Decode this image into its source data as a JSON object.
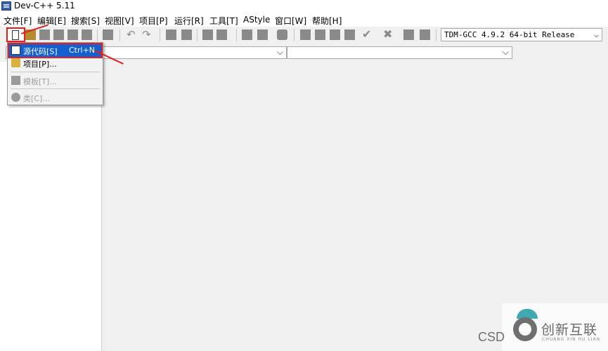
{
  "window": {
    "title": "Dev-C++ 5.11"
  },
  "menu": [
    "文件[F]",
    "编辑[E]",
    "搜索[S]",
    "视图[V]",
    "项目[P]",
    "运行[R]",
    "工具[T]",
    "AStyle",
    "窗口[W]",
    "帮助[H]"
  ],
  "toolbar": {
    "compiler_selected": "TDM-GCC 4.9.2 64-bit Release",
    "buttons": [
      "new-file",
      "open",
      "save",
      "save-all",
      "close",
      "print",
      "undo",
      "redo",
      "indent",
      "unindent",
      "toggle-bookmark",
      "goto-bookmark",
      "goto",
      "new-project",
      "add-to-project",
      "remove-from-project",
      "compile",
      "run",
      "compile-run",
      "rebuild",
      "debug",
      "stop",
      "profile",
      "clean",
      "options"
    ]
  },
  "new_menu": {
    "items": [
      {
        "label": "源代码[S]",
        "shortcut": "Ctrl+N",
        "enabled": true,
        "selected": true,
        "icon": "file-icon"
      },
      {
        "label": "项目[P]...",
        "shortcut": "",
        "enabled": true,
        "selected": false,
        "icon": "project-icon"
      },
      {
        "label": "模板[T]...",
        "shortcut": "",
        "enabled": false,
        "selected": false,
        "icon": "template-icon"
      },
      {
        "label": "类[C]...",
        "shortcut": "",
        "enabled": false,
        "selected": false,
        "icon": "class-icon"
      }
    ]
  },
  "watermark": {
    "csd": "CSD",
    "brand": "创新互联",
    "brand_sub": "CHUANG XIN HU LIAN"
  },
  "colors": {
    "accent_red": "#e02020",
    "selection_blue": "#1560d0"
  }
}
